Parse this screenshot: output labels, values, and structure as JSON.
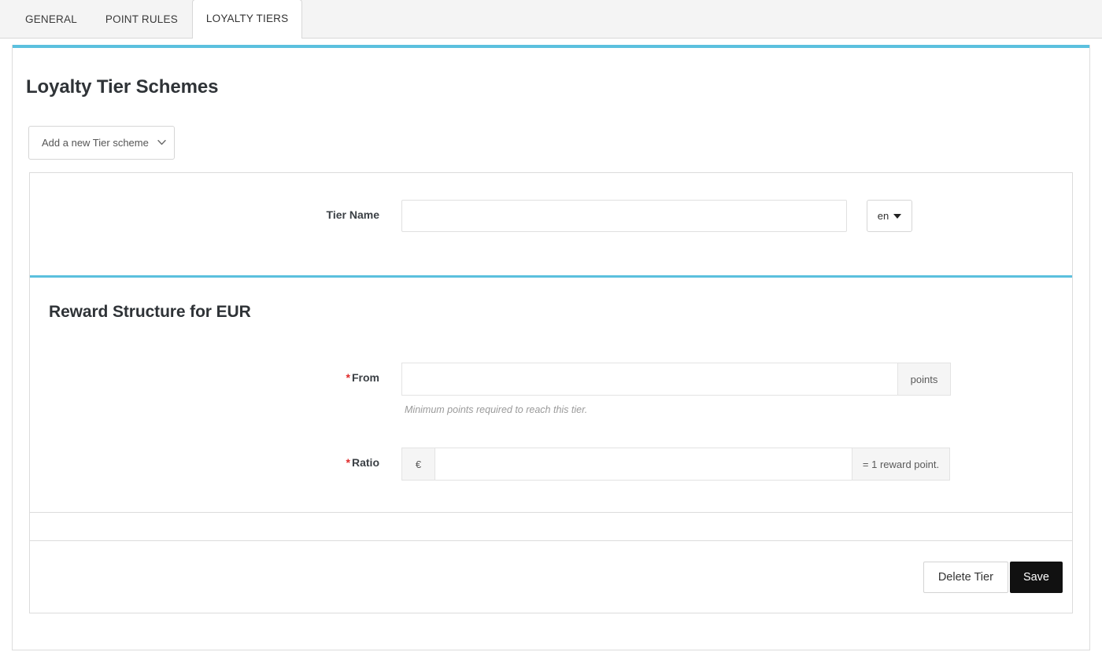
{
  "tabs": [
    {
      "label": "GENERAL",
      "active": false
    },
    {
      "label": "POINT RULES",
      "active": false
    },
    {
      "label": "LOYALTY TIERS",
      "active": true
    }
  ],
  "page": {
    "title": "Loyalty Tier Schemes"
  },
  "scheme_selector": {
    "selected": "Add a new Tier scheme",
    "options": [
      "Add a new Tier scheme"
    ],
    "caret_icon": "chevron-down-icon"
  },
  "tier_name": {
    "label": "Tier Name",
    "value": "",
    "placeholder": "",
    "language_button": {
      "label": "en",
      "caret_icon": "caret-down-icon"
    }
  },
  "reward_structure": {
    "title": "Reward Structure for EUR",
    "from": {
      "label": "From",
      "required_marker": "*",
      "value": "",
      "placeholder": "",
      "addon_suffix": "points",
      "help_text": "Minimum points required to reach this tier."
    },
    "ratio": {
      "label": "Ratio",
      "required_marker": "*",
      "value": "",
      "placeholder": "",
      "addon_prefix": "€",
      "addon_suffix": "= 1 reward point."
    }
  },
  "footer": {
    "delete_label": "Delete Tier",
    "save_label": "Save"
  },
  "colors": {
    "accent": "#5bc0de",
    "required": "#e02b2b",
    "save_bg": "#111111",
    "tabbar_bg": "#f4f4f4",
    "addon_bg": "#f5f5f5"
  }
}
